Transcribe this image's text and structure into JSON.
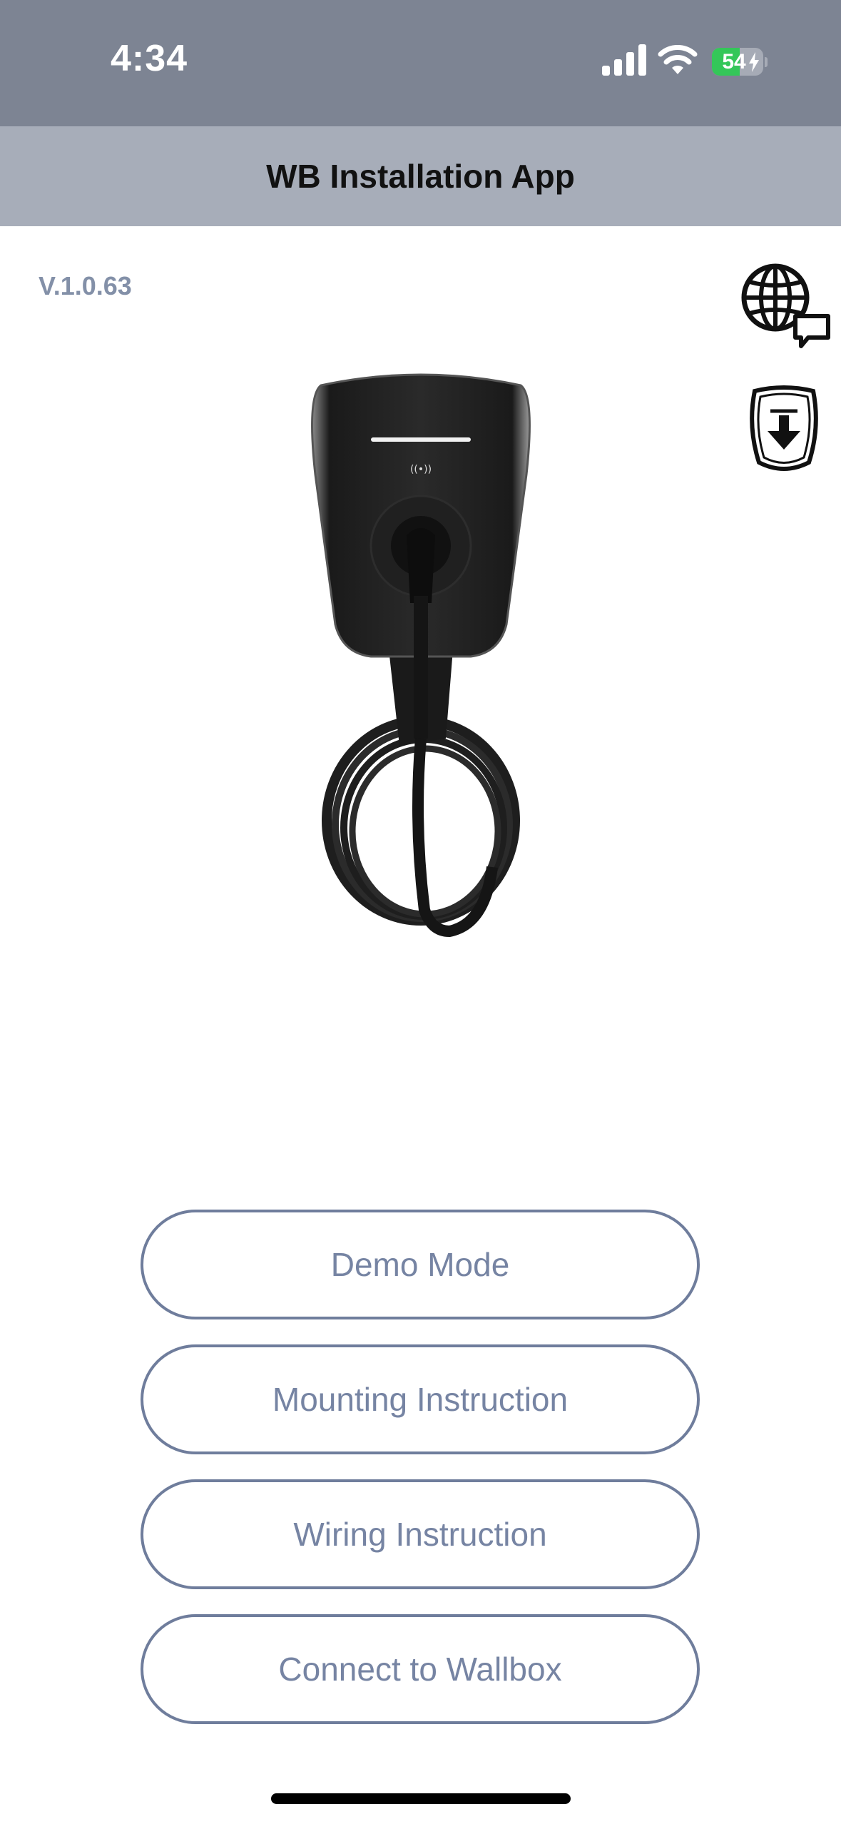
{
  "status_bar": {
    "time": "4:34",
    "battery_percent": 54,
    "battery_label": "54",
    "charging": true,
    "signal_icon": "cellular-signal-icon",
    "wifi_icon": "wifi-icon"
  },
  "header": {
    "title": "WB Installation App"
  },
  "version": "V.1.0.63",
  "icons": {
    "language": "globe-chat-icon",
    "download": "download-arrow-icon"
  },
  "product_image": "wallbox-charger",
  "buttons": [
    {
      "label": "Demo Mode"
    },
    {
      "label": "Mounting Instruction"
    },
    {
      "label": "Wiring Instruction"
    },
    {
      "label": "Connect to Wallbox"
    }
  ],
  "colors": {
    "status_bar": "#7d8493",
    "header": "#a7adb9",
    "button_border": "#6f7d9c",
    "button_text": "#7684a3",
    "version_text": "#8390a8",
    "battery_fill": "#34c759"
  }
}
